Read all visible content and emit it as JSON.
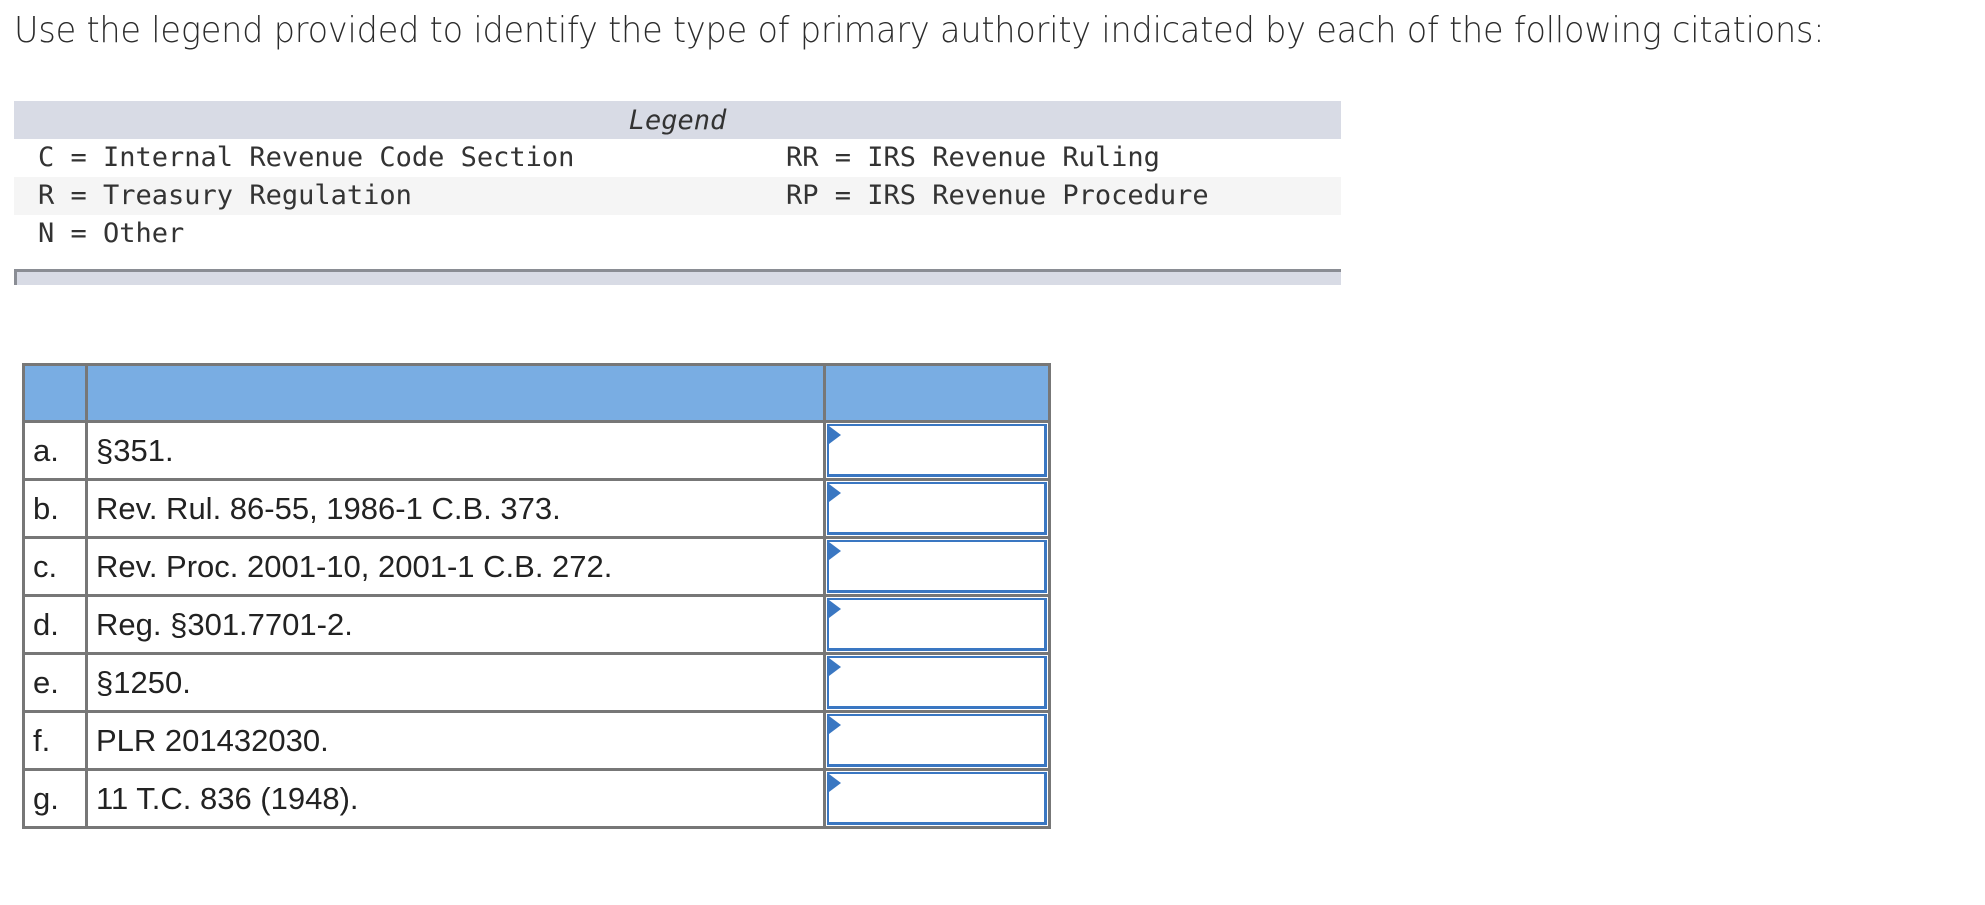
{
  "prompt": "Use the legend provided to identify the type of primary authority indicated by each of the following citations:",
  "legend": {
    "title": "Legend",
    "rows": [
      {
        "left": "C = Internal Revenue Code Section",
        "right": "RR = IRS Revenue Ruling"
      },
      {
        "left": "R = Treasury Regulation",
        "right": "RP = IRS Revenue Procedure"
      },
      {
        "left": "N = Other",
        "right": ""
      }
    ]
  },
  "table": {
    "headers": [
      "",
      "",
      ""
    ],
    "rows": [
      {
        "label": "a.",
        "citation": "§351.",
        "answer": ""
      },
      {
        "label": "b.",
        "citation": "Rev. Rul. 86-55, 1986-1 C.B. 373.",
        "answer": ""
      },
      {
        "label": "c.",
        "citation": "Rev. Proc. 2001-10, 2001-1 C.B. 272.",
        "answer": ""
      },
      {
        "label": "d.",
        "citation": "Reg. §301.7701-2.",
        "answer": ""
      },
      {
        "label": "e.",
        "citation": "§1250.",
        "answer": ""
      },
      {
        "label": "f.",
        "citation": "PLR 201432030.",
        "answer": ""
      },
      {
        "label": "g.",
        "citation": "11 T.C. 836 (1948).",
        "answer": ""
      }
    ]
  },
  "colors": {
    "header_blue": "#79ade3",
    "input_border": "#3a77c2",
    "legend_band": "#d8dbe5"
  }
}
